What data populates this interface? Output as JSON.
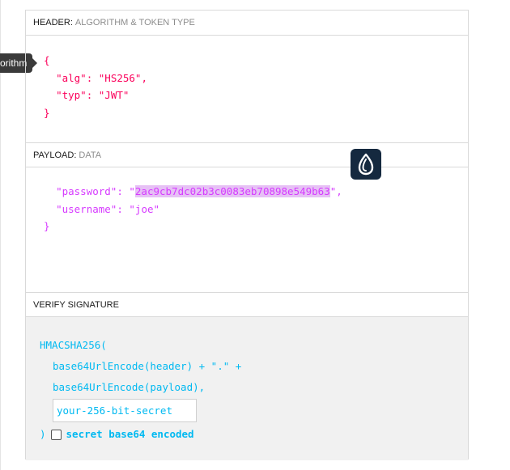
{
  "tooltip": {
    "text": "orithm"
  },
  "header": {
    "title": "HEADER:",
    "subtitle": "ALGORITHM & TOKEN TYPE",
    "json": {
      "open": "{",
      "alg_key": "\"alg\"",
      "alg_value": "\"HS256\"",
      "typ_key": "\"typ\"",
      "typ_value": "\"JWT\"",
      "close": "}"
    }
  },
  "payload": {
    "title": "PAYLOAD:",
    "subtitle": "DATA",
    "json": {
      "password_key": "\"password\"",
      "password_value": "2ac9cb7dc02b3c0083eb70898e549b63",
      "username_key": "\"username\"",
      "username_value": "\"joe\"",
      "close": "}"
    }
  },
  "verify": {
    "title": "VERIFY SIGNATURE",
    "line1": "HMACSHA256(",
    "line2": "base64UrlEncode(header) + \".\" +",
    "line3": "base64UrlEncode(payload),",
    "secret_placeholder": "your-256-bit-secret",
    "close": ")",
    "checkbox_label": "secret base64 encoded",
    "checkbox_checked": false
  },
  "colors": {
    "header_json": "#fb015b",
    "payload_json": "#d63aff",
    "signature": "#00b9f1",
    "highlight": "#e6c0f5"
  },
  "icons": {
    "badge": "droplet-app-icon"
  }
}
